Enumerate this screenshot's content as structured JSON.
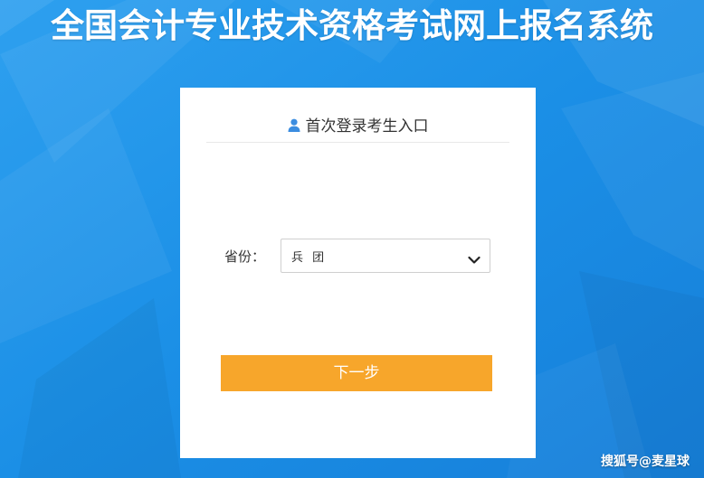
{
  "page": {
    "title": "全国会计专业技术资格考试网上报名系统"
  },
  "login_card": {
    "title": "首次登录考生入口",
    "icon": "user-icon",
    "province_label": "省份：",
    "province_value": "兵 团",
    "next_button_label": "下一步"
  },
  "watermark": {
    "text": "搜狐号@麦星球"
  },
  "colors": {
    "background": "#1e90e6",
    "card": "#ffffff",
    "button": "#f7a62b",
    "icon_accent": "#3b8de0"
  }
}
